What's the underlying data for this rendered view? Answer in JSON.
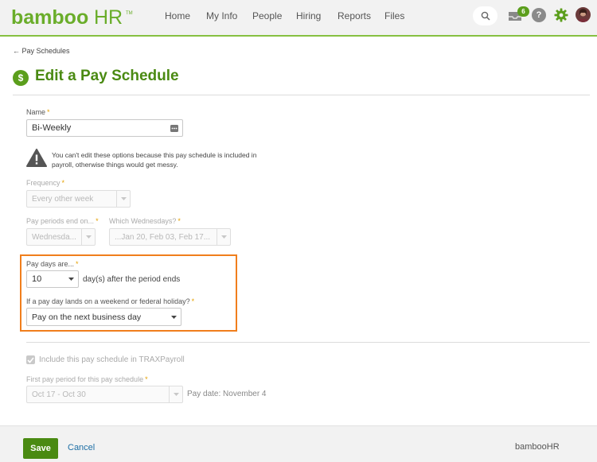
{
  "header": {
    "logo_text": "bambooHR",
    "nav": [
      "Home",
      "My Info",
      "People",
      "Hiring",
      "Reports",
      "Files"
    ],
    "inbox_badge": "6",
    "icons": [
      "search-icon",
      "inbox-icon",
      "help-icon",
      "gear-icon",
      "avatar"
    ],
    "accent_color": "#86c041"
  },
  "breadcrumb": "← Pay Schedules",
  "title": "Edit a Pay Schedule",
  "title_icon": "$",
  "name_field": {
    "label": "Name",
    "value": "Bi-Weekly"
  },
  "warning": "You can't edit these options because this pay schedule is included in payroll, otherwise things would get messy.",
  "frequency": {
    "label": "Frequency",
    "value": "Every other week"
  },
  "pay_periods_end": {
    "label": "Pay periods end on...",
    "value": "Wednesda..."
  },
  "which_wednesdays": {
    "label": "Which Wednesdays?",
    "value": "...Jan 20, Feb 03, Feb 17..."
  },
  "pay_days": {
    "label": "Pay days are...",
    "value": "10",
    "suffix": "day(s) after the period ends"
  },
  "holiday": {
    "label": "If a pay day lands on a weekend or federal holiday?",
    "value": "Pay on the next business day"
  },
  "trax": {
    "label": "Include this pay schedule in TRAXPayroll",
    "checked": true
  },
  "first_period": {
    "label": "First pay period for this pay schedule",
    "value": "Oct 17 - Oct 30",
    "pay_date": "Pay date: November 4"
  },
  "footer": {
    "save": "Save",
    "cancel": "Cancel",
    "logo": "bambooHR"
  },
  "required_mark": "*"
}
